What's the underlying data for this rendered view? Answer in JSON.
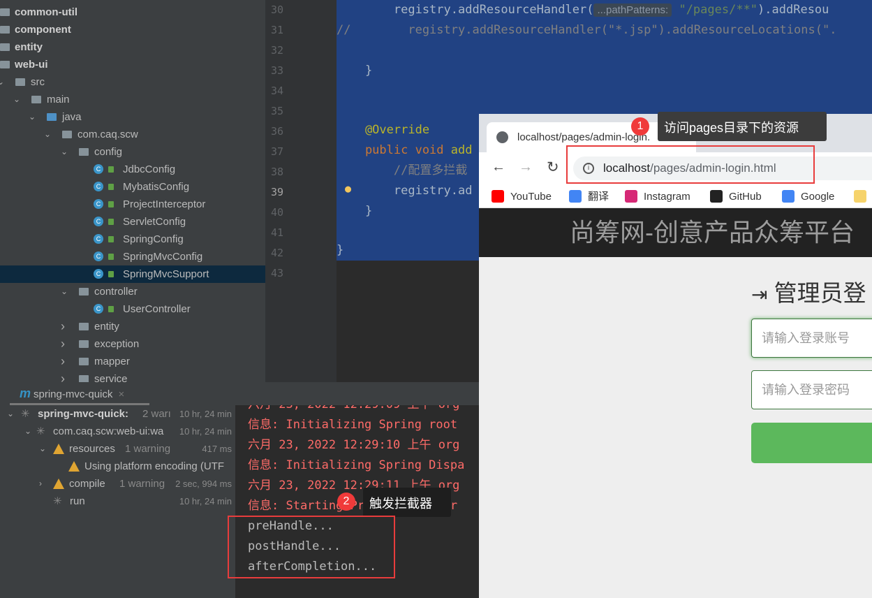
{
  "project_tree": [
    {
      "label": "common-util",
      "level": 0,
      "bold": true
    },
    {
      "label": "component",
      "level": 0,
      "bold": true
    },
    {
      "label": "entity",
      "level": 0,
      "bold": true
    },
    {
      "label": "web-ui",
      "level": 0,
      "bold": true
    },
    {
      "label": "src",
      "level": 1,
      "arrow": "down"
    },
    {
      "label": "main",
      "level": 2,
      "arrow": "down"
    },
    {
      "label": "java",
      "level": 3,
      "arrow": "down",
      "blue": true
    },
    {
      "label": "com.caq.scw",
      "level": 4,
      "arrow": "down"
    },
    {
      "label": "config",
      "level": 5,
      "arrow": "down"
    },
    {
      "label": "JdbcConfig",
      "level": 6,
      "cls": true
    },
    {
      "label": "MybatisConfig",
      "level": 6,
      "cls": true
    },
    {
      "label": "ProjectInterceptor",
      "level": 6,
      "cls": true
    },
    {
      "label": "ServletConfig",
      "level": 6,
      "cls": true
    },
    {
      "label": "SpringConfig",
      "level": 6,
      "cls": true
    },
    {
      "label": "SpringMvcConfig",
      "level": 6,
      "cls": true
    },
    {
      "label": "SpringMvcSupport",
      "level": 6,
      "cls": true,
      "selected": true
    },
    {
      "label": "controller",
      "level": 5,
      "arrow": "down"
    },
    {
      "label": "UserController",
      "level": 6,
      "cls": true
    },
    {
      "label": "entity",
      "level": 5,
      "arrow": "right"
    },
    {
      "label": "exception",
      "level": 5,
      "arrow": "right"
    },
    {
      "label": "mapper",
      "level": 5,
      "arrow": "right"
    },
    {
      "label": "service",
      "level": 5,
      "arrow": "right"
    }
  ],
  "editor": {
    "line_numbers": [
      "30",
      "31",
      "32",
      "33",
      "34",
      "35",
      "36",
      "37",
      "38",
      "39",
      "40",
      "41",
      "42",
      "43"
    ],
    "lines": {
      "l30a": "        registry.addResourceHandler(",
      "l30hint": "...pathPatterns:",
      "l30str": "\"/pages/**\"",
      "l30b": ").addResou",
      "l31": "//        registry.addResourceHandler(\"*.jsp\").addResourceLocations(\".",
      "l33": "    }",
      "l36": "    @Override",
      "l37kw": "    public void ",
      "l37b": "add",
      "l38": "        //配置多拦截",
      "l39": "        registry.ad",
      "l40": "    }",
      "l42": "}"
    }
  },
  "run_panel": {
    "tab_label": "spring-mvc-quick",
    "build": [
      {
        "label": "spring-mvc-quick:",
        "extra": "2 warı",
        "time": "10 hr, 24 min"
      },
      {
        "label": "com.caq.scw:web-ui:wa",
        "extra": "",
        "time": "10 hr, 24 min"
      },
      {
        "label": "resources",
        "extra": "1 warning",
        "time": "417 ms"
      },
      {
        "label": "Using platform encoding (UTF",
        "extra": "",
        "time": ""
      },
      {
        "label": "compile",
        "extra": "1 warning",
        "time": "2 sec, 994 ms"
      },
      {
        "label": "run",
        "extra": "",
        "time": "10 hr, 24 min"
      }
    ],
    "console": [
      "六月 23, 2022 12:29:09 上午 org",
      "信息: Initializing Spring root",
      "六月 23, 2022 12:29:10 上午 org",
      "信息: Initializing Spring Dispa",
      "六月 23, 2022 12:29:11 上午 org",
      "信息: Starting ProtocolHandler",
      "preHandle...",
      "postHandle...",
      "afterCompletion..."
    ]
  },
  "browser": {
    "tab_title": "localhost/pages/admin-login.",
    "url_host": "localhost",
    "url_path": "/pages/admin-login.html",
    "bookmarks": [
      {
        "label": "YouTube",
        "color": "#ff0000"
      },
      {
        "label": "翻译",
        "color": "#4285f4"
      },
      {
        "label": "Instagram",
        "color": "#d62976"
      },
      {
        "label": "GitHub",
        "color": "#222222"
      },
      {
        "label": "Google",
        "color": "#4285f4"
      }
    ],
    "page_title": "尚筹网-创意产品众筹平台",
    "login_heading": "管理员登",
    "account_placeholder": "请输入登录账号",
    "password_placeholder": "请输入登录密码"
  },
  "annotations": [
    {
      "number": "1",
      "text": "访问pages目录下的资源"
    },
    {
      "number": "2",
      "text": "触发拦截器"
    }
  ],
  "colors": {
    "accent_red": "#e83c3c",
    "selection": "#214283",
    "login_button": "#5cb85c"
  }
}
